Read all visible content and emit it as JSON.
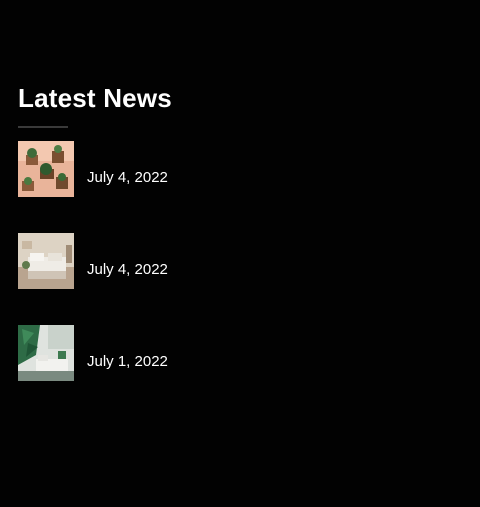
{
  "widget": {
    "title": "Latest News",
    "accent_underline": "#3a3a3a",
    "background": "#020202"
  },
  "posts": [
    {
      "date": "July 4, 2022",
      "thumbnail_icon": "plants-shelf-image"
    },
    {
      "date": "July 4, 2022",
      "thumbnail_icon": "bedroom-image"
    },
    {
      "date": "July 1, 2022",
      "thumbnail_icon": "green-livingroom-image"
    }
  ]
}
